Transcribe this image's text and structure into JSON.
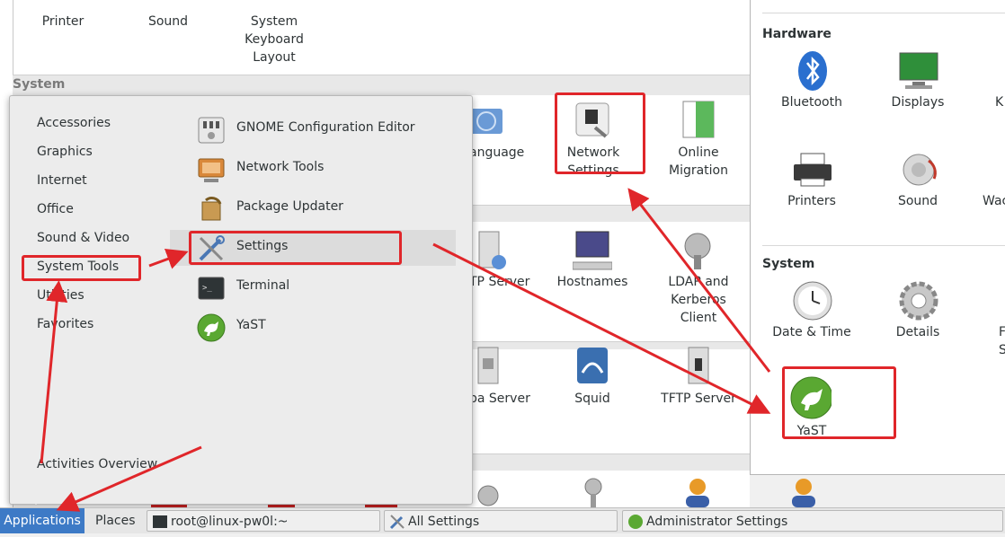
{
  "background_window": {
    "top_items": [
      {
        "label": "Printer",
        "icon": "printer-icon"
      },
      {
        "label": "Sound",
        "icon": "sound-icon"
      },
      {
        "label": "System Keyboard Layout",
        "label_lines": [
          "System",
          "Keyboard",
          "Layout"
        ],
        "icon": "keyboard-icon"
      }
    ],
    "section_system": "System",
    "items": [
      {
        "label": "anguage",
        "icon": "language-icon"
      },
      {
        "label": "Network Settings",
        "label_lines": [
          "Network",
          "Settings"
        ],
        "icon": "network-settings-icon"
      },
      {
        "label": "Online Migration",
        "label_lines": [
          "Online",
          "Migration"
        ],
        "icon": "online-migration-icon"
      },
      {
        "label": "TP Server",
        "icon": "tp-server-icon"
      },
      {
        "label": "Hostnames",
        "icon": "hostnames-icon"
      },
      {
        "label": "LDAP and Kerberos Client",
        "label_lines": [
          "LDAP and",
          "Kerberos",
          "Client"
        ],
        "icon": "ldap-icon"
      },
      {
        "label": "ba Server",
        "icon": "samba-server-icon"
      },
      {
        "label": "Squid",
        "icon": "squid-icon"
      },
      {
        "label": "TFTP Server",
        "icon": "tftp-server-icon"
      }
    ]
  },
  "app_menu": {
    "categories": [
      "Accessories",
      "Graphics",
      "Internet",
      "Office",
      "Sound & Video",
      "System Tools",
      "Utilities",
      "Favorites"
    ],
    "selected_category": "System Tools",
    "activities": "Activities Overview",
    "sub_items": [
      {
        "label": "GNOME Configuration Editor",
        "icon": "gconf-editor-icon"
      },
      {
        "label": "Network Tools",
        "icon": "network-tools-icon"
      },
      {
        "label": "Package Updater",
        "icon": "package-updater-icon"
      },
      {
        "label": "Settings",
        "icon": "settings-tools-icon"
      },
      {
        "label": "Terminal",
        "icon": "terminal-icon"
      },
      {
        "label": "YaST",
        "icon": "yast-icon"
      }
    ],
    "hovered_item": "Settings"
  },
  "settings_window": {
    "hardware_title": "Hardware",
    "hardware_items": [
      {
        "label": "Bluetooth",
        "icon": "bluetooth-icon"
      },
      {
        "label": "Displays",
        "icon": "displays-icon"
      },
      {
        "label": "K",
        "icon": "keyboard-icon"
      },
      {
        "label": "Printers",
        "icon": "printers-icon"
      },
      {
        "label": "Sound",
        "icon": "sound-icon"
      },
      {
        "label": "Wac",
        "icon": "wacom-icon"
      }
    ],
    "system_title": "System",
    "system_items": [
      {
        "label": "Date & Time",
        "icon": "clock-icon"
      },
      {
        "label": "Details",
        "icon": "gear-icon"
      },
      {
        "label": "F",
        "label_lines": [
          "F",
          "S"
        ],
        "icon": "unknown-icon"
      },
      {
        "label": "YaST",
        "icon": "yast-icon"
      }
    ]
  },
  "taskbar": {
    "applications": "Applications",
    "places": "Places",
    "tasks": [
      {
        "label": "root@linux-pw0l:~",
        "icon": "terminal-icon"
      },
      {
        "label": "All Settings",
        "icon": "settings-tools-icon"
      },
      {
        "label": "Administrator Settings",
        "icon": "yast-icon"
      }
    ]
  },
  "colors": {
    "accent": "#3d7ac6",
    "annotation_red": "#e0262a",
    "menu_bg": "#ececec",
    "hover_bg": "#dcdcdc"
  }
}
